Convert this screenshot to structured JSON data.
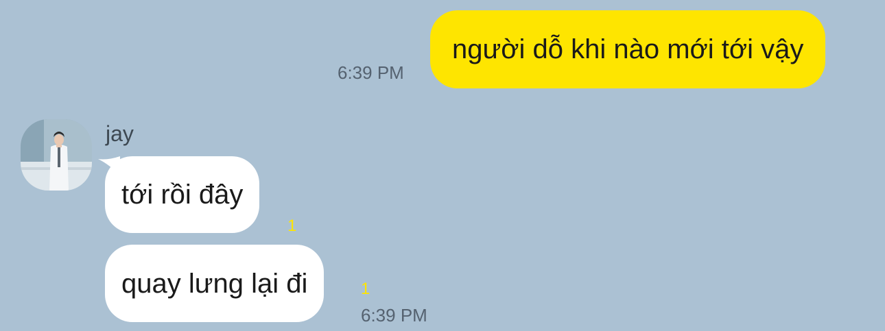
{
  "chat": {
    "messages": [
      {
        "direction": "outgoing",
        "text": "người dỗ khi nào mới tới vậy",
        "time": "6:39 PM"
      },
      {
        "direction": "incoming",
        "sender": "jay",
        "text": "tới rồi đây",
        "unread_count": "1"
      },
      {
        "direction": "incoming",
        "text": "quay lưng lại đi",
        "unread_count": "1",
        "time": "6:39 PM"
      }
    ]
  },
  "colors": {
    "background": "#abc1d3",
    "outgoing_bubble": "#fee500",
    "incoming_bubble": "#ffffff",
    "unread_count": "#fee500"
  },
  "icons": {
    "avatar": "profile-photo"
  }
}
